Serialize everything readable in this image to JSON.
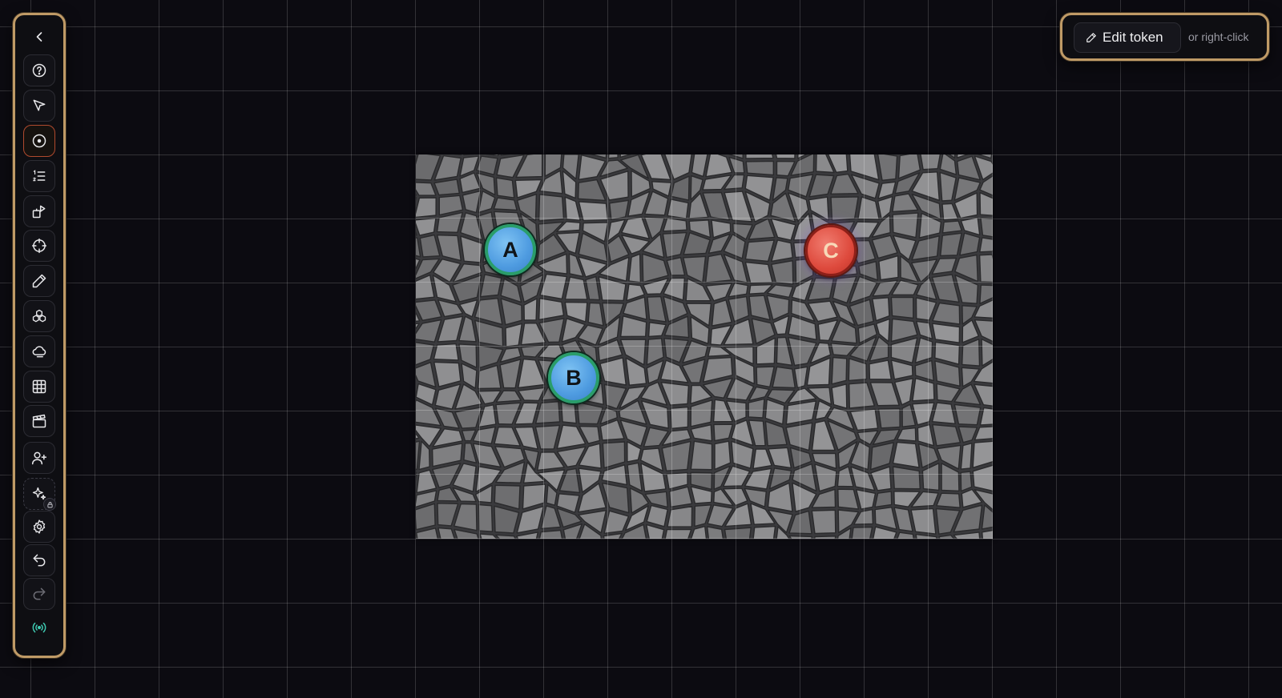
{
  "toolbar": {
    "tools": [
      {
        "name": "collapse",
        "icon": "chevron-left-icon"
      },
      {
        "name": "help",
        "icon": "help-circle-icon"
      },
      {
        "name": "select",
        "icon": "pointer-icon"
      },
      {
        "name": "token",
        "icon": "token-circle-icon",
        "active": true
      },
      {
        "name": "initiative",
        "icon": "numbered-list-icon"
      },
      {
        "name": "shapes",
        "icon": "shapes-icon"
      },
      {
        "name": "measure",
        "icon": "crosshair-icon"
      },
      {
        "name": "draw",
        "icon": "pencil-icon"
      },
      {
        "name": "assets",
        "icon": "stack-icon"
      },
      {
        "name": "fog",
        "icon": "cloud-icon"
      },
      {
        "name": "grid",
        "icon": "grid-icon"
      },
      {
        "name": "scenes",
        "icon": "clapperboard-icon"
      },
      {
        "name": "invite-player",
        "icon": "user-plus-icon"
      },
      {
        "name": "ai-generate",
        "icon": "sparkles-icon",
        "locked": true
      },
      {
        "name": "settings",
        "icon": "gear-icon"
      },
      {
        "name": "undo",
        "icon": "undo-icon"
      },
      {
        "name": "redo",
        "icon": "redo-icon",
        "disabled": true
      },
      {
        "name": "broadcast",
        "icon": "broadcast-icon"
      }
    ]
  },
  "hint": {
    "edit_label": "Edit token",
    "alt_text": "or right-click"
  },
  "tokens": [
    {
      "label": "A",
      "color": "#4e9be0"
    },
    {
      "label": "B",
      "color": "#4e9be0"
    },
    {
      "label": "C",
      "color": "#de4a3d"
    }
  ],
  "colors": {
    "accent_border": "#bf9a66",
    "active_tool": "#b04a2e",
    "broadcast": "#3ec9b0"
  }
}
